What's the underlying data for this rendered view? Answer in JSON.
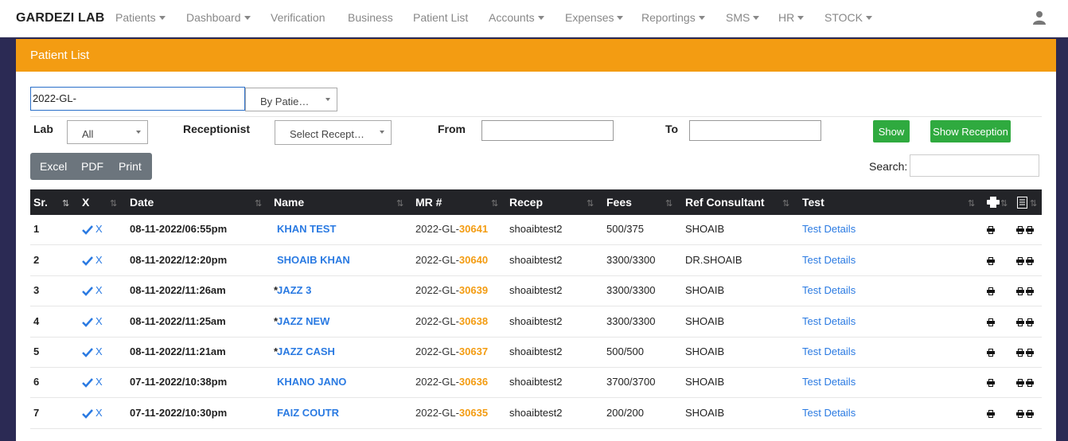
{
  "nav": {
    "brand": "GARDEZI LAB",
    "items": [
      {
        "label": "Patients",
        "dropdown": true
      },
      {
        "label": "Dashboard",
        "dropdown": true
      },
      {
        "label": "Verification",
        "dropdown": false
      },
      {
        "label": "Business",
        "dropdown": false
      },
      {
        "label": "Patient List",
        "dropdown": false
      },
      {
        "label": "Accounts",
        "dropdown": true
      },
      {
        "label": "Expenses",
        "dropdown": true
      },
      {
        "label": "Reportings",
        "dropdown": true
      },
      {
        "label": "SMS",
        "dropdown": true
      },
      {
        "label": "HR",
        "dropdown": true
      },
      {
        "label": "STOCK",
        "dropdown": true
      }
    ],
    "user_icon": "user-icon"
  },
  "panel": {
    "title": "Patient List",
    "search_value": "2022-GL-",
    "search_by": "By Patie…",
    "lab_label": "Lab",
    "lab_value": "All",
    "receptionist_label": "Receptionist",
    "receptionist_value": "Select Recept…",
    "from_label": "From",
    "to_label": "To",
    "show_button": "Show",
    "show_reception_button": "Show Reception",
    "export_buttons": [
      "Excel",
      "PDF",
      "Print"
    ],
    "table_search_label": "Search:"
  },
  "table": {
    "headers": [
      "Sr.",
      "X",
      "Date",
      "Name",
      "MR #",
      "Recep",
      "Fees",
      "Ref Consultant",
      "Test"
    ],
    "rows": [
      {
        "sr": "1",
        "x": "X",
        "date": "08-11-2022/06:55pm",
        "prefix": "",
        "name": "KHAN TEST",
        "mr_prefix": "2022-GL-",
        "mr_num": "30641",
        "recep": "shoaibtest2",
        "fees": "500/375",
        "ref": "SHOAIB",
        "test": "Test Details"
      },
      {
        "sr": "2",
        "x": "X",
        "date": "08-11-2022/12:20pm",
        "prefix": "",
        "name": "SHOAIB KHAN",
        "mr_prefix": "2022-GL-",
        "mr_num": "30640",
        "recep": "shoaibtest2",
        "fees": "3300/3300",
        "ref": "DR.SHOAIB",
        "test": "Test Details"
      },
      {
        "sr": "3",
        "x": "X",
        "date": "08-11-2022/11:26am",
        "prefix": "*",
        "name": "JAZZ 3",
        "mr_prefix": "2022-GL-",
        "mr_num": "30639",
        "recep": "shoaibtest2",
        "fees": "3300/3300",
        "ref": "SHOAIB",
        "test": "Test Details"
      },
      {
        "sr": "4",
        "x": "X",
        "date": "08-11-2022/11:25am",
        "prefix": "*",
        "name": "JAZZ NEW",
        "mr_prefix": "2022-GL-",
        "mr_num": "30638",
        "recep": "shoaibtest2",
        "fees": "3300/3300",
        "ref": "SHOAIB",
        "test": "Test Details"
      },
      {
        "sr": "5",
        "x": "X",
        "date": "08-11-2022/11:21am",
        "prefix": "*",
        "name": "JAZZ CASH",
        "mr_prefix": "2022-GL-",
        "mr_num": "30637",
        "recep": "shoaibtest2",
        "fees": "500/500",
        "ref": "SHOAIB",
        "test": "Test Details"
      },
      {
        "sr": "6",
        "x": "X",
        "date": "07-11-2022/10:38pm",
        "prefix": "",
        "name": "KHANO JANO",
        "mr_prefix": "2022-GL-",
        "mr_num": "30636",
        "recep": "shoaibtest2",
        "fees": "3700/3700",
        "ref": "SHOAIB",
        "test": "Test Details"
      },
      {
        "sr": "7",
        "x": "X",
        "date": "07-11-2022/10:30pm",
        "prefix": "",
        "name": "FAIZ COUTR",
        "mr_prefix": "2022-GL-",
        "mr_num": "30635",
        "recep": "shoaibtest2",
        "fees": "200/200",
        "ref": "SHOAIB",
        "test": "Test Details"
      }
    ]
  },
  "colors": {
    "accent": "#f39c12",
    "link": "#2a7ae2",
    "success": "#2faa3f",
    "header_dark": "#232428"
  }
}
